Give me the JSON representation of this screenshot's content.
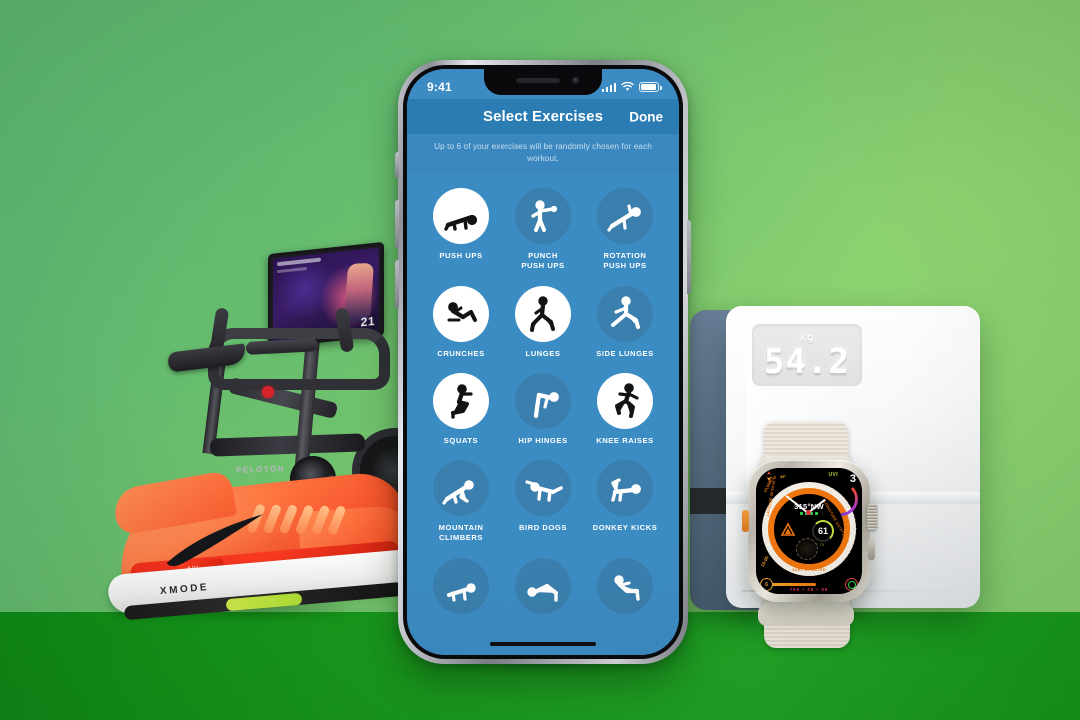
{
  "background": {
    "top_color": "#6cc06d",
    "bottom_band_color": "#18991c"
  },
  "phone": {
    "status_bar": {
      "time": "9:41",
      "signal_icon": "cellular-signal-icon",
      "wifi_icon": "wifi-icon",
      "battery_icon": "battery-icon"
    },
    "nav": {
      "title": "Select Exercises",
      "done_label": "Done",
      "bar_color": "#2b7cb3"
    },
    "subtitle": "Up to 6 of your exercises will be randomly chosen for each workout.",
    "screen_bg_color": "#3c8cc4",
    "selected_disc_color": "#ffffff",
    "unselected_disc_color": "#3a7fae",
    "exercises": [
      {
        "label": "PUSH UPS",
        "icon": "push-up-icon",
        "selected": true
      },
      {
        "label": "PUNCH\nPUSH UPS",
        "icon": "punch-push-up-icon",
        "selected": false
      },
      {
        "label": "ROTATION\nPUSH UPS",
        "icon": "rotation-push-up-icon",
        "selected": false
      },
      {
        "label": "CRUNCHES",
        "icon": "crunch-icon",
        "selected": true
      },
      {
        "label": "LUNGES",
        "icon": "lunge-icon",
        "selected": true
      },
      {
        "label": "SIDE LUNGES",
        "icon": "side-lunge-icon",
        "selected": false
      },
      {
        "label": "SQUATS",
        "icon": "squat-icon",
        "selected": true
      },
      {
        "label": "HIP HINGES",
        "icon": "hip-hinge-icon",
        "selected": false
      },
      {
        "label": "KNEE RAISES",
        "icon": "knee-raise-icon",
        "selected": true
      },
      {
        "label": "MOUNTAIN\nCLIMBERS",
        "icon": "mountain-climber-icon",
        "selected": false
      },
      {
        "label": "BIRD DOGS",
        "icon": "bird-dog-icon",
        "selected": false
      },
      {
        "label": "DONKEY KICKS",
        "icon": "donkey-kick-icon",
        "selected": false
      },
      {
        "label": "",
        "icon": "plank-icon",
        "selected": false
      },
      {
        "label": "",
        "icon": "glute-bridge-icon",
        "selected": false
      },
      {
        "label": "",
        "icon": "sit-up-icon",
        "selected": false
      }
    ]
  },
  "scale": {
    "unit": "kg",
    "weight": "54.2"
  },
  "watch": {
    "heading": "315°NW",
    "heart_rate": "61",
    "heart_rate_range": "53  70",
    "uvi_label": "UVI",
    "uvi_value": "3",
    "tilt": "45°",
    "elevation": "14,508FT",
    "time_small": "15:00",
    "status": "JUST UPDATED",
    "latitude": "LATITUDE 36°54'42\"N",
    "longitude": "LONGITUDE 111°27'31\"W",
    "bearing_numbers": [
      "30",
      "60",
      "120",
      "150",
      "210",
      "240",
      "300",
      "330"
    ],
    "bottom_left_complication": "6",
    "bottom_numbers": "700 • 35 • 05"
  },
  "bike": {
    "brand": "PELOTON",
    "screen_metric": "21"
  },
  "shoe": {
    "brand_mark": "swoosh-icon",
    "midsole_text": "XMODE",
    "tab_text": "4%"
  }
}
